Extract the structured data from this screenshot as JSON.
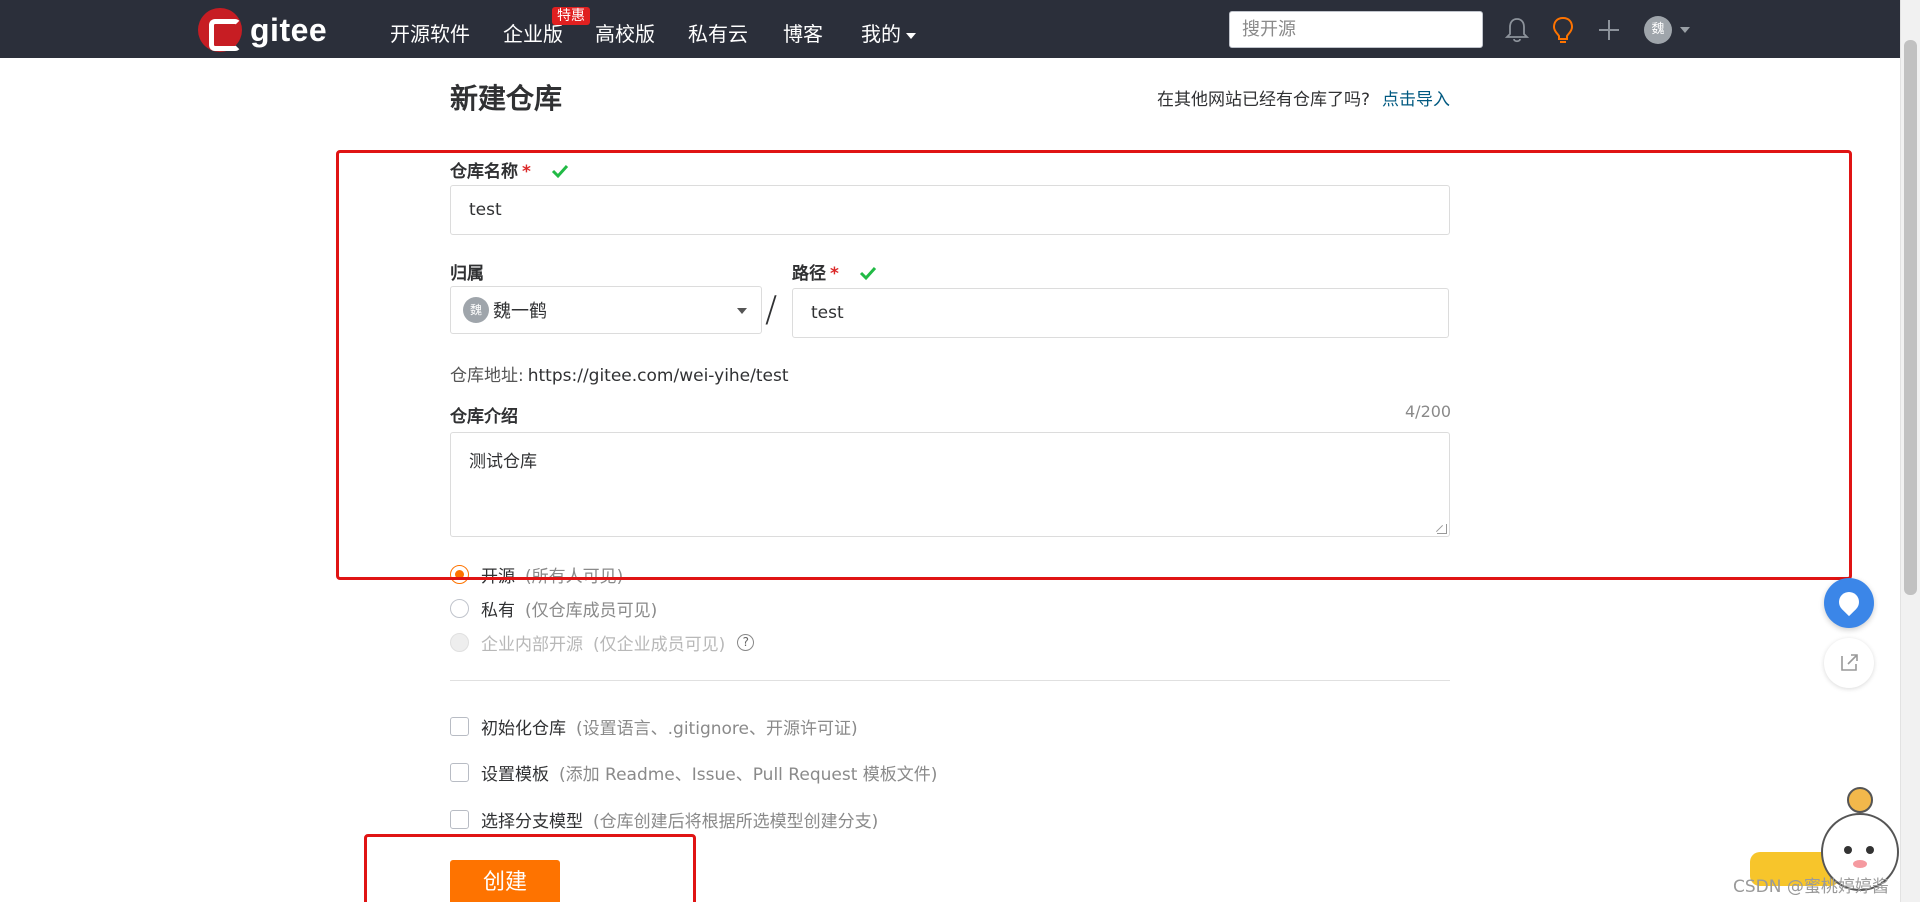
{
  "navbar": {
    "logo_text": "gitee",
    "items": [
      "开源软件",
      "企业版",
      "高校版",
      "私有云",
      "博客",
      "我的"
    ],
    "badge": "特惠",
    "search_placeholder": "搜开源",
    "avatar_char": "魏"
  },
  "page": {
    "title": "新建仓库",
    "import_prompt": "在其他网站已经有仓库了吗?",
    "import_link": "点击导入"
  },
  "form": {
    "repo_name_label": "仓库名称",
    "required_mark": "*",
    "repo_name_value": "test",
    "owner_label": "归属",
    "owner_value": "魏一鹤",
    "owner_avatar_char": "魏",
    "path_label": "路径",
    "path_value": "test",
    "separator": "/",
    "address_label": "仓库地址:",
    "address_value": "https://gitee.com/wei-yihe/test",
    "intro_label": "仓库介绍",
    "intro_counter": "4/200",
    "intro_value": "测试仓库",
    "visibility": [
      {
        "label": "开源",
        "hint": "(所有人可见)",
        "selected": true
      },
      {
        "label": "私有",
        "hint": "(仅仓库成员可见)",
        "selected": false
      },
      {
        "label": "企业内部开源",
        "hint": "(仅企业成员可见)",
        "selected": false,
        "disabled": true
      }
    ],
    "options": [
      {
        "label": "初始化仓库",
        "hint": "(设置语言、.gitignore、开源许可证)"
      },
      {
        "label": "设置模板",
        "hint": "(添加 Readme、Issue、Pull Request 模板文件)"
      },
      {
        "label": "选择分支模型",
        "hint": "(仓库创建后将根据所选模型创建分支)"
      }
    ],
    "create_button": "创建"
  },
  "watermark": "CSDN @蜜桃婷婷酱",
  "colors": {
    "navbar_bg": "#2b2f3a",
    "brand_red": "#c71d23",
    "accent_orange": "#fe7300",
    "annotation_red": "#e01414",
    "check_green": "#21ba45",
    "link_blue": "#005980"
  }
}
